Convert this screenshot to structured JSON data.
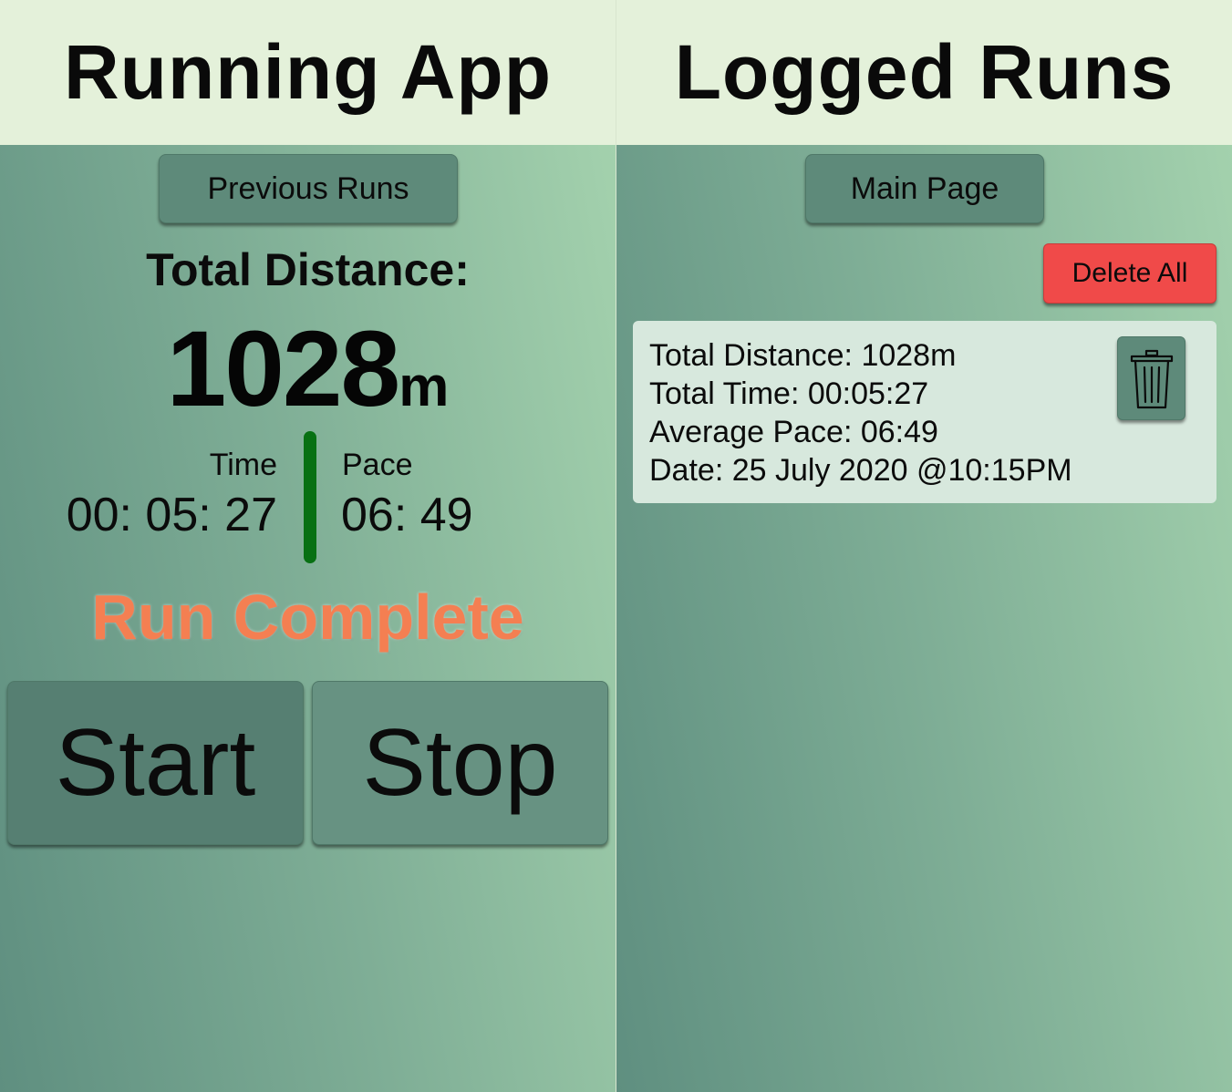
{
  "running_app": {
    "title": "Running App",
    "previous_runs_button": "Previous Runs",
    "total_distance_label": "Total Distance:",
    "distance_value": "1028",
    "distance_unit": "m",
    "time_label": "Time",
    "time_value": "00: 05: 27",
    "pace_label": "Pace",
    "pace_value": "06: 49",
    "status_text": "Run Complete",
    "start_button": "Start",
    "stop_button": "Stop",
    "status_color": "#f47f52",
    "divider_color": "#087013"
  },
  "logged_runs": {
    "title": "Logged Runs",
    "main_page_button": "Main Page",
    "delete_all_button": "Delete All",
    "delete_all_color": "#f04a49",
    "runs": [
      {
        "total_distance": "Total Distance: 1028m",
        "total_time": "Total Time: 00:05:27",
        "average_pace": "Average Pace: 06:49",
        "date": "Date: 25 July 2020 @10:15PM",
        "delete_icon": "trash-icon"
      }
    ]
  }
}
